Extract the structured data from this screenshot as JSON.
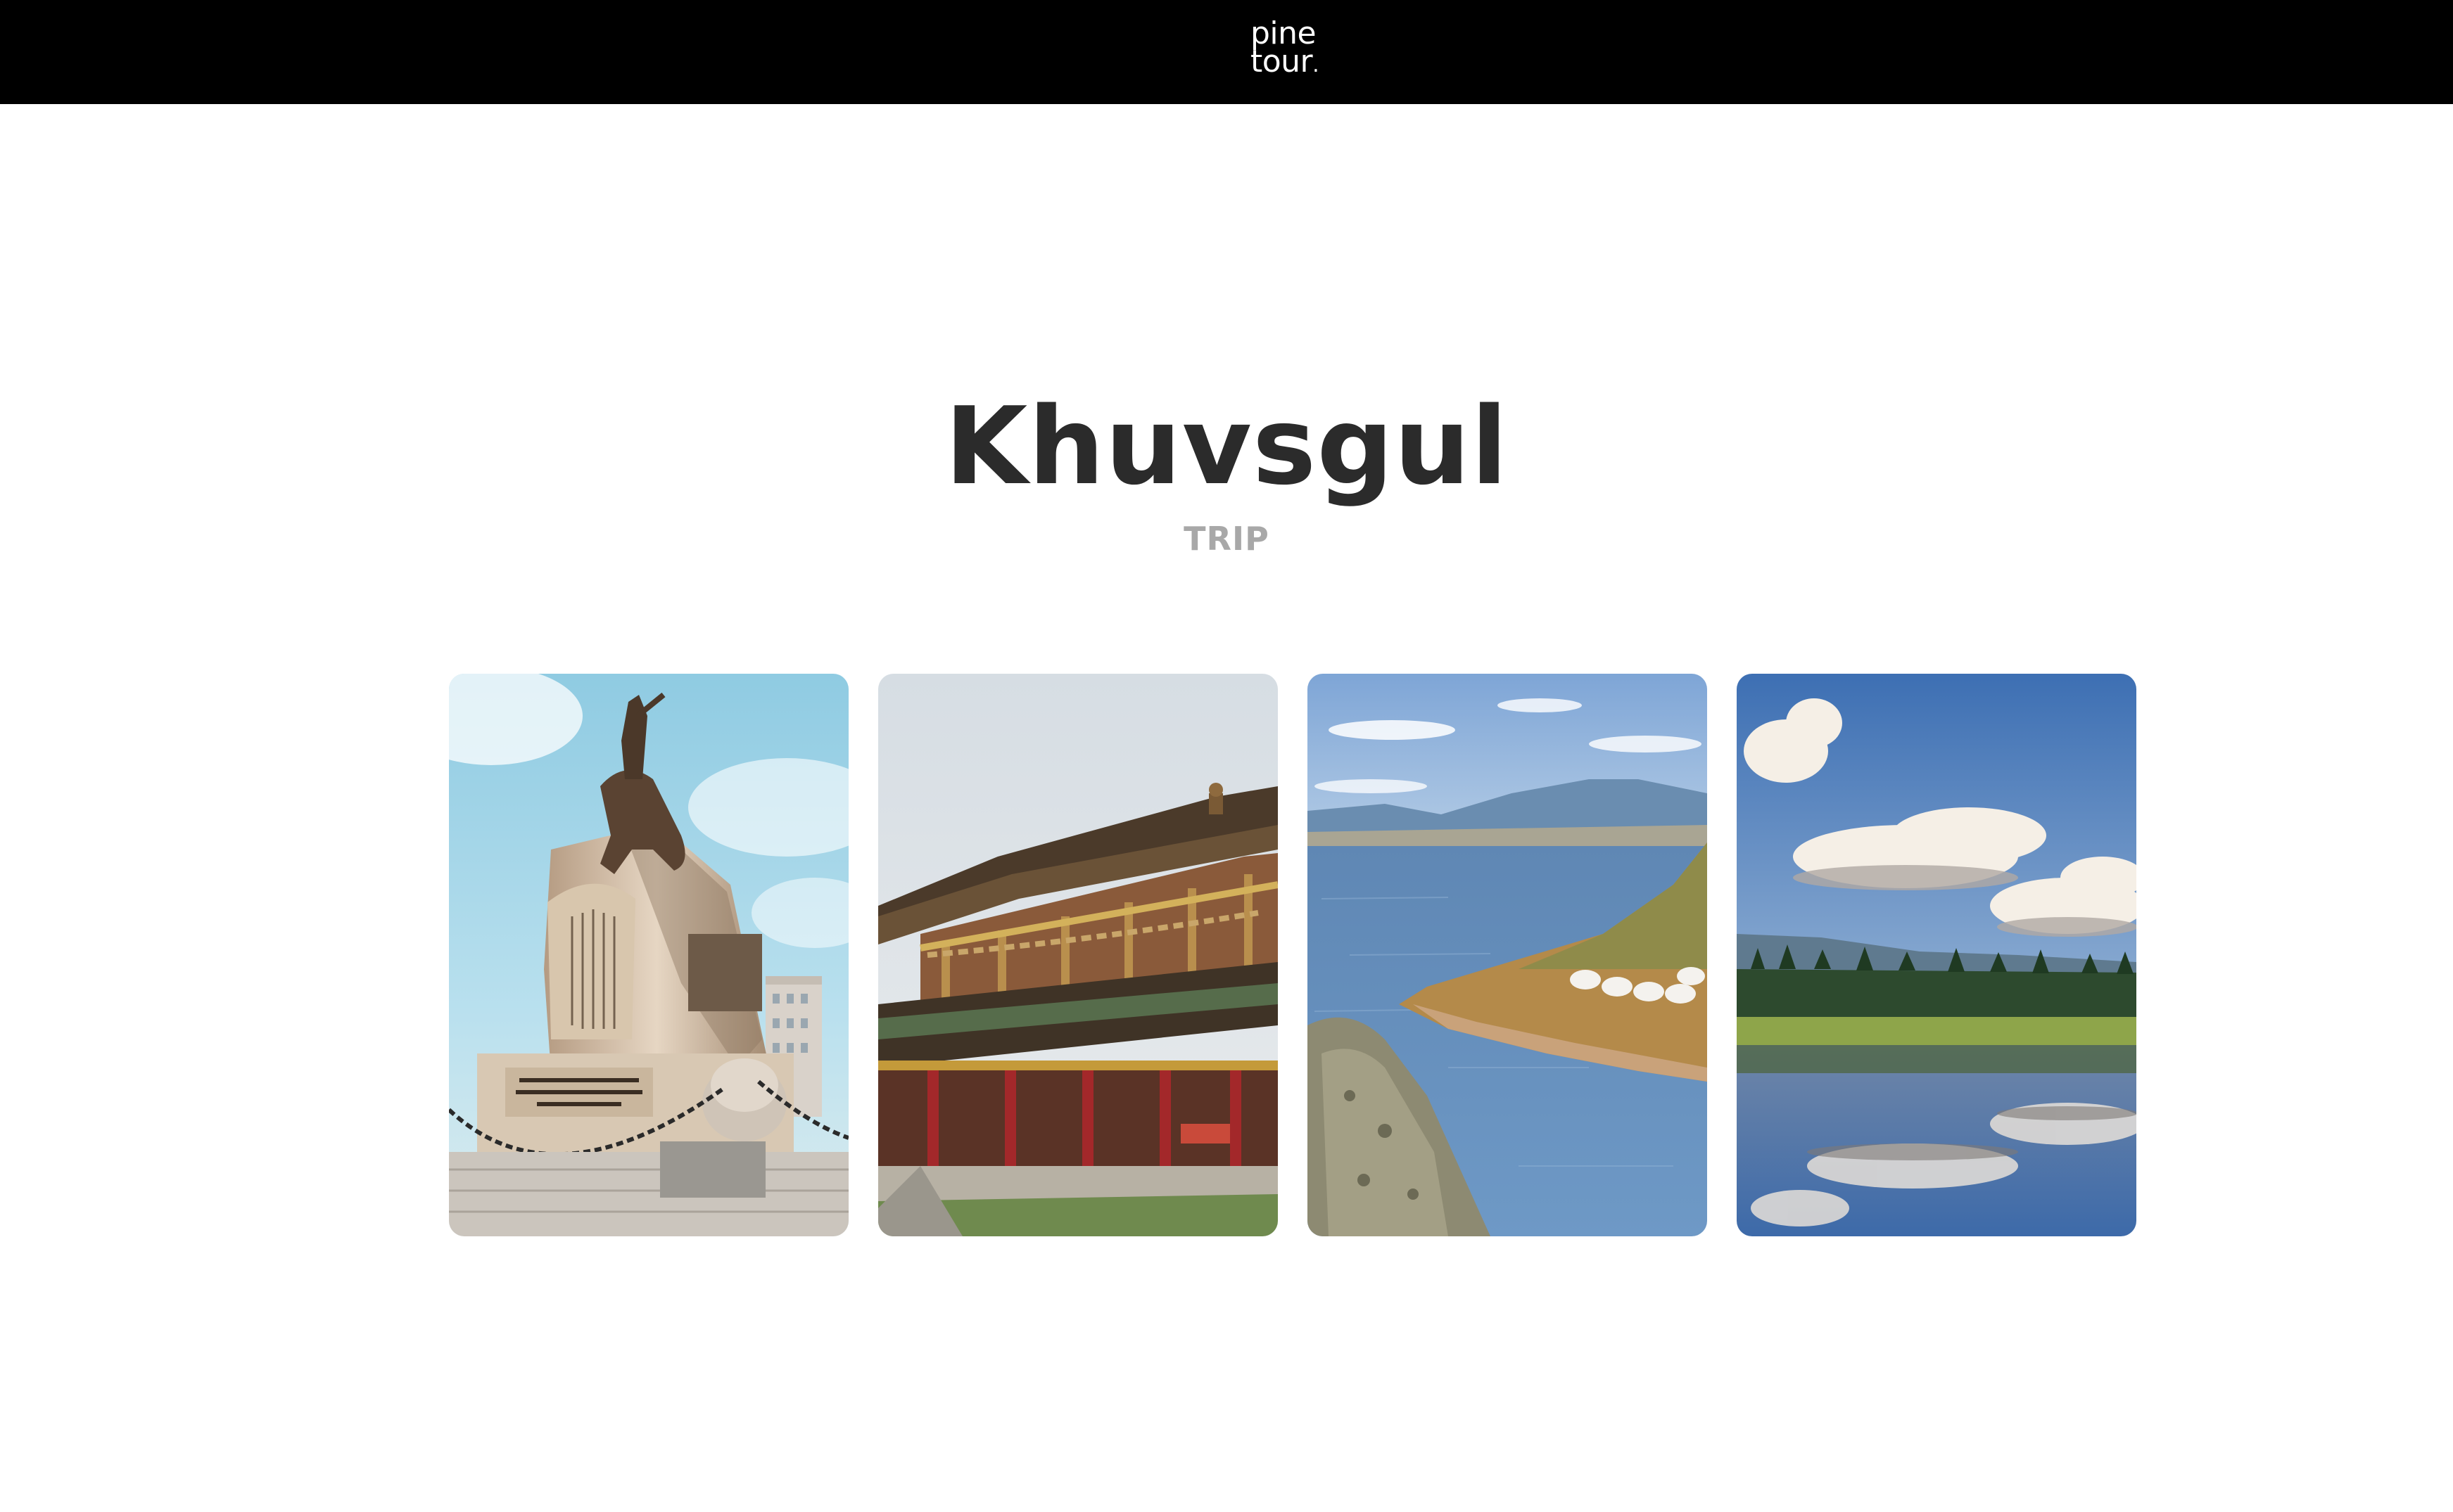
{
  "header": {
    "logo_line1": "pine",
    "logo_line2": "tour",
    "logo_dot": "."
  },
  "hero": {
    "title": "Khuvsgul",
    "subtitle": "TRIP"
  },
  "gallery": {
    "photos": [
      {
        "subject": "equestrian-statue-monument"
      },
      {
        "subject": "temple-monastery"
      },
      {
        "subject": "lake-shore-ger-camp"
      },
      {
        "subject": "lake-reflection-clouds"
      }
    ]
  },
  "colors": {
    "topbar": "#000000",
    "title": "#2b2b2b",
    "subtitle": "#a8a8a8",
    "background": "#ffffff"
  }
}
